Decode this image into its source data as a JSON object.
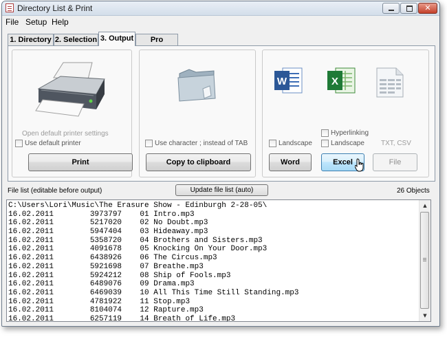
{
  "window": {
    "title": "Directory List & Print"
  },
  "menu": [
    "File",
    "Setup",
    "Help"
  ],
  "tabs": [
    {
      "label": "1. Directory",
      "active": false
    },
    {
      "label": "2. Selection",
      "active": false
    },
    {
      "label": "3. Output",
      "active": true
    },
    {
      "label": "Pro Licence",
      "active": false
    }
  ],
  "print_group": {
    "icon": "printer-icon",
    "open_settings": "Open default printer settings",
    "use_default_printer": "Use default printer",
    "button": "Print"
  },
  "clipboard_group": {
    "icon": "folder-icon",
    "use_character": "Use character  ;  instead of TAB",
    "button": "Copy to clipboard"
  },
  "export_group": {
    "word_icon": "word-icon",
    "excel_icon": "excel-icon",
    "txt_icon": "text-file-icon",
    "word_landscape": "Landscape",
    "excel_hyperlinking": "Hyperlinking",
    "excel_landscape": "Landscape",
    "txt_label": "TXT, CSV",
    "word_button": "Word",
    "excel_button": "Excel",
    "file_button": "File"
  },
  "file_list": {
    "label": "File list (editable before output)",
    "update_button": "Update file list (auto)",
    "count": "26 Objects",
    "lines": [
      "C:\\Users\\Lori\\Music\\The Erasure Show - Edinburgh 2-28-05\\",
      "16.02.2011        3973797    01 Intro.mp3",
      "16.02.2011        5217020    02 No Doubt.mp3",
      "16.02.2011        5947404    03 Hideaway.mp3",
      "16.02.2011        5358720    04 Brothers and Sisters.mp3",
      "16.02.2011        4091678    05 Knocking On Your Door.mp3",
      "16.02.2011        6438926    06 The Circus.mp3",
      "16.02.2011        5921698    07 Breathe.mp3",
      "16.02.2011        5924212    08 Ship of Fools.mp3",
      "16.02.2011        6489076    09 Drama.mp3",
      "16.02.2011        6469039    10 All This Time Still Standing.mp3",
      "16.02.2011        4781922    11 Stop.mp3",
      "16.02.2011        8104074    12 Rapture.mp3",
      "16.02.2011        6257119    14 Breath of Life.mp3"
    ]
  }
}
